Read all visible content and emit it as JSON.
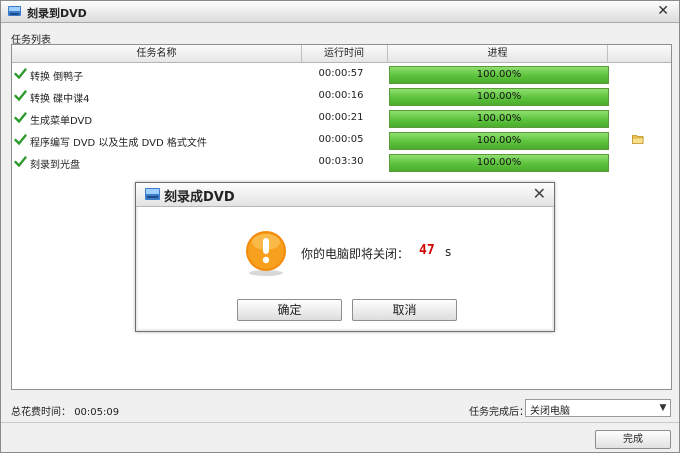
{
  "window": {
    "title": "刻录到DVD",
    "close_glyph": "✕"
  },
  "task_list": {
    "label": "任务列表",
    "columns": [
      "任务名称",
      "运行时间",
      "进程"
    ],
    "rows": [
      {
        "name": "转换 倒鸭子",
        "time": "00:00:57",
        "progress_pct": 100,
        "progress_text": "100.00%",
        "has_folder": false
      },
      {
        "name": "转换 碟中谍4",
        "time": "00:00:16",
        "progress_pct": 100,
        "progress_text": "100.00%",
        "has_folder": false
      },
      {
        "name": "生成菜单DVD",
        "time": "00:00:21",
        "progress_pct": 100,
        "progress_text": "100.00%",
        "has_folder": false
      },
      {
        "name": "程序编写 DVD 以及生成 DVD 格式文件",
        "time": "00:00:05",
        "progress_pct": 100,
        "progress_text": "100.00%",
        "has_folder": true
      },
      {
        "name": "刻录到光盘",
        "time": "00:03:30",
        "progress_pct": 100,
        "progress_text": "100.00%",
        "has_folder": false
      }
    ]
  },
  "footer": {
    "total_label": "总花费时间：",
    "total_value": "00:05:09",
    "after_label": "任务完成后：",
    "after_value": "关闭电脑",
    "done_button": "完成"
  },
  "dialog": {
    "title": "刻录成DVD",
    "close_glyph": "✕",
    "message": "你的电脑即将关闭：",
    "countdown": "47",
    "unit": "s",
    "ok_button": "确定",
    "cancel_button": "取消"
  },
  "colors": {
    "progress_green": "#5cc23c",
    "check_green": "#2e9a2e",
    "countdown_red": "#d00000",
    "warning_orange": "#f28a0c"
  }
}
